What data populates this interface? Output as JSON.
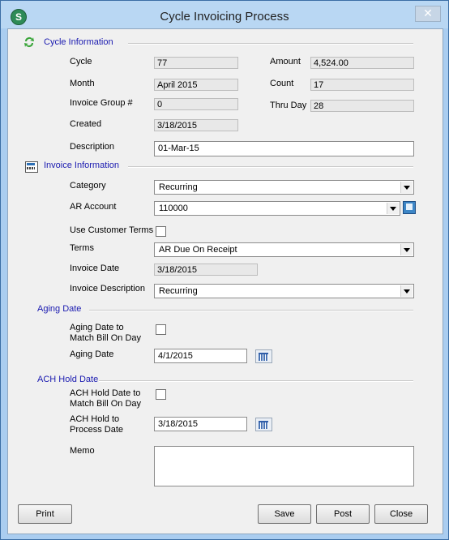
{
  "window": {
    "title": "Cycle Invoicing Process",
    "app_icon": "S",
    "close_glyph": "✕"
  },
  "cycle_info": {
    "header": "Cycle Information",
    "cycle_label": "Cycle",
    "cycle_value": "77",
    "month_label": "Month",
    "month_value": "April 2015",
    "invoice_group_label": "Invoice Group #",
    "invoice_group_value": "0",
    "created_label": "Created",
    "created_value": "3/18/2015",
    "amount_label": "Amount",
    "amount_value": "4,524.00",
    "count_label": "Count",
    "count_value": "17",
    "thru_day_label": "Thru Day",
    "thru_day_value": "28",
    "description_label": "Description",
    "description_value": "01-Mar-15"
  },
  "invoice_info": {
    "header": "Invoice Information",
    "category_label": "Category",
    "category_value": "Recurring",
    "ar_account_label": "AR Account",
    "ar_account_value": "110000",
    "use_customer_terms_label": "Use Customer Terms",
    "use_customer_terms_checked": false,
    "terms_label": "Terms",
    "terms_value": "AR Due On Receipt",
    "invoice_date_label": "Invoice Date",
    "invoice_date_value": "3/18/2015",
    "invoice_description_label": "Invoice Description",
    "invoice_description_value": "Recurring"
  },
  "aging": {
    "header": "Aging Date",
    "match_line1": "Aging Date to",
    "match_line2": "Match Bill On Day",
    "match_checked": false,
    "date_label": "Aging Date",
    "date_value": "4/1/2015"
  },
  "ach": {
    "header": "ACH Hold Date",
    "match_line1": "ACH Hold Date to",
    "match_line2": "Match Bill On Day",
    "match_checked": false,
    "process_line1": "ACH Hold to",
    "process_line2": "Process Date",
    "process_value": "3/18/2015"
  },
  "memo": {
    "label": "Memo",
    "value": ""
  },
  "buttons": {
    "print": "Print",
    "save": "Save",
    "post": "Post",
    "close": "Close"
  },
  "colors": {
    "section_header": "#1a1ab0",
    "frame": "#aacdf0"
  }
}
